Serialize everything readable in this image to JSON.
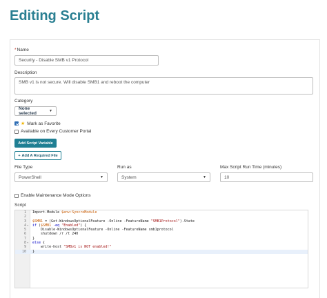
{
  "page": {
    "title": "Editing Script"
  },
  "form": {
    "name": {
      "label": "Name",
      "required_mark": "*",
      "value": "Security - Disable SMB v1 Protocol"
    },
    "description": {
      "label": "Description",
      "value": "SMB v1 is not secure. Will disable SMB1 and reboot the computer"
    },
    "category": {
      "label": "Category",
      "value": "None selected"
    },
    "favorite": {
      "label": "Mark as Favorite",
      "checked": true
    },
    "customer_portal": {
      "label": "Available on Every Customer Portal",
      "checked": false
    },
    "add_variable_label": "Add Script Variable",
    "add_file_label": "Add A Required File",
    "file_type": {
      "label": "File Type",
      "value": "PowerShell"
    },
    "run_as": {
      "label": "Run as",
      "value": "System"
    },
    "max_runtime": {
      "label": "Max Script Run Time (minutes)",
      "value": "10"
    },
    "maintenance_mode": {
      "label": "Enable Maintenance Mode Options",
      "checked": false
    },
    "script_label": "Script"
  },
  "script_lines": [
    {
      "n": "1",
      "fold": "",
      "text": "Import-Module $env:SyncroModule"
    },
    {
      "n": "2",
      "fold": "",
      "text": ""
    },
    {
      "n": "3",
      "fold": "",
      "text": "$SMB1 = (Get-WindowsOptionalFeature -Online -FeatureName \"SMB1Protocol\").State"
    },
    {
      "n": "4",
      "fold": "▾",
      "text": "if ($SMB1 -eq \"Enabled\") {"
    },
    {
      "n": "5",
      "fold": "",
      "text": "    Disable-WindowsOptionalFeature -Online -FeatureName smb1protocol"
    },
    {
      "n": "6",
      "fold": "",
      "text": "    shutdown /r /t 240"
    },
    {
      "n": "7",
      "fold": "",
      "text": "}"
    },
    {
      "n": "8",
      "fold": "▾",
      "text": "else {"
    },
    {
      "n": "9",
      "fold": "",
      "text": "    write-host \"SMBv1 is NOT enabled!\""
    },
    {
      "n": "10",
      "fold": "",
      "text": "}"
    }
  ],
  "icons": {
    "favorite": "star-icon",
    "add_file": "plus-icon",
    "caret": "caret-down-icon"
  },
  "colors": {
    "accent": "#1f7f93",
    "title": "#2a7f92",
    "checkbox": "#2f6eb5",
    "star": "#f0b400"
  }
}
